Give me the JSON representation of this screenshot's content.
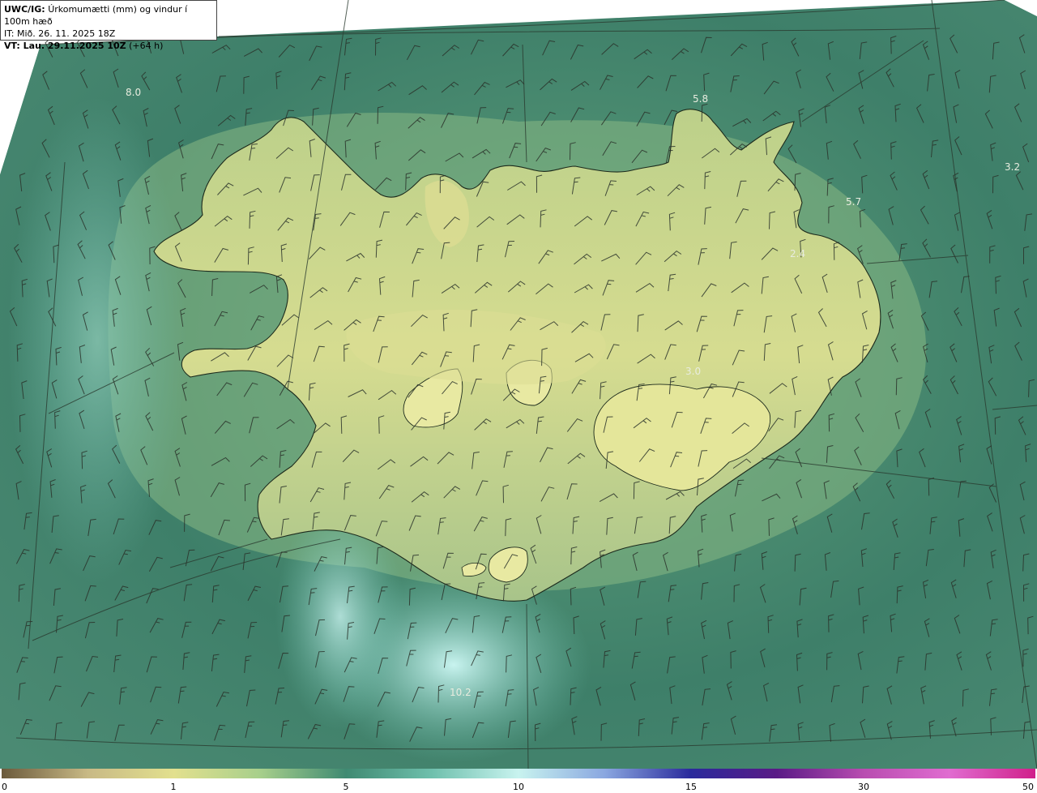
{
  "header": {
    "product_prefix": "UWC/IG:",
    "product_title": "Úrkomumætti (mm) og vindur í 100m hæð",
    "issue_time": "IT: Mið. 26. 11. 2025 18Z",
    "valid_prefix": "VT: Lau. 29.11.2025 10Z",
    "valid_offset": "(+64 h)"
  },
  "map_labels": [
    {
      "name": "label-west-sea",
      "text": "8.0"
    },
    {
      "name": "label-north-coast",
      "text": "5.8"
    },
    {
      "name": "label-northeast-far",
      "text": "3.2"
    },
    {
      "name": "label-northeast",
      "text": "5.7"
    },
    {
      "name": "label-east-fjords",
      "text": "2.4"
    },
    {
      "name": "label-central-east",
      "text": "3.0"
    },
    {
      "name": "label-south-sea",
      "text": "10.2"
    }
  ],
  "colorbar": {
    "ticks": [
      {
        "label": "0",
        "value": 0
      },
      {
        "label": "1",
        "value": 1
      },
      {
        "label": "5",
        "value": 5
      },
      {
        "label": "10",
        "value": 10
      },
      {
        "label": "15",
        "value": 15
      },
      {
        "label": "30",
        "value": 30
      },
      {
        "label": "50",
        "value": 50
      }
    ],
    "colors": [
      "#6b5a3c",
      "#c8b985",
      "#e2e08e",
      "#a7cf8b",
      "#3f8a72",
      "#6fc0ad",
      "#c8f3ef",
      "#8aa7e0",
      "#2a2a9c",
      "#5a1a86",
      "#b84cb0",
      "#e06cd0",
      "#d0208a"
    ]
  },
  "colors": {
    "land": "#c9d68a",
    "sea": "#3e7f69",
    "coast": "#1c2a1c"
  }
}
